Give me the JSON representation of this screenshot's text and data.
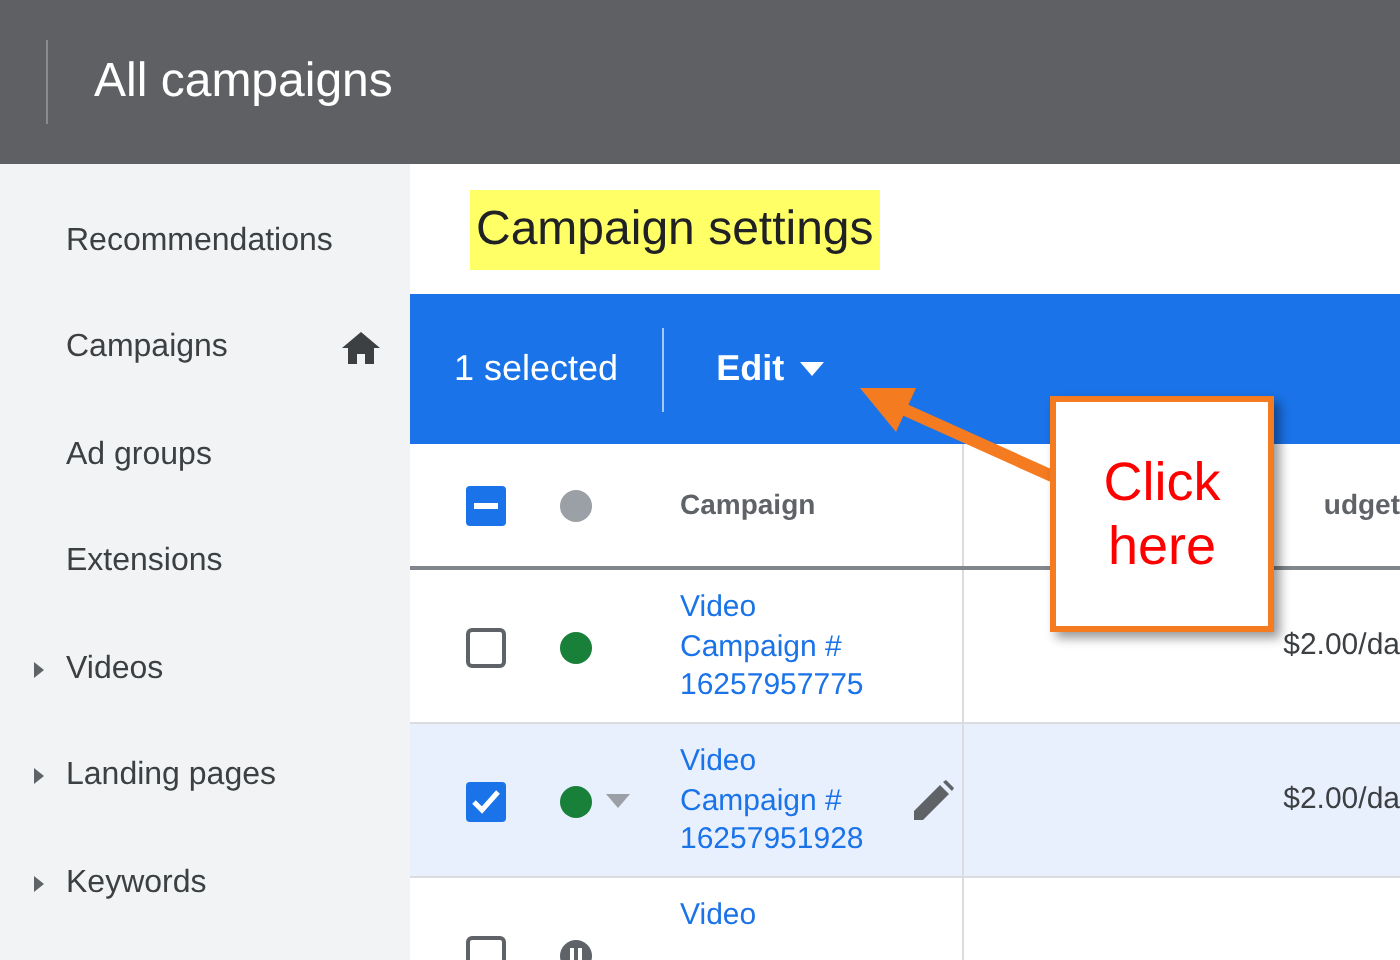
{
  "header": {
    "title": "All campaigns"
  },
  "sidebar": {
    "items": [
      {
        "label": "Recommendations",
        "expandable": false,
        "home": false
      },
      {
        "label": "Campaigns",
        "expandable": false,
        "home": true
      },
      {
        "label": "Ad groups",
        "expandable": false,
        "home": false
      },
      {
        "label": "Extensions",
        "expandable": false,
        "home": false
      },
      {
        "label": "Videos",
        "expandable": true,
        "home": false
      },
      {
        "label": "Landing pages",
        "expandable": true,
        "home": false
      },
      {
        "label": "Keywords",
        "expandable": true,
        "home": false
      }
    ]
  },
  "page_title": "Campaign settings",
  "action_bar": {
    "count": "1 selected",
    "edit": "Edit"
  },
  "table": {
    "select_all_indeterminate": true,
    "columns": [
      "Campaign",
      "udget"
    ],
    "rows": [
      {
        "selected": false,
        "kind": "enabled",
        "hovered": false,
        "campaign": "Video Campaign # 16257957775",
        "budget": "$2.00/da"
      },
      {
        "selected": true,
        "kind": "enabled",
        "hovered": true,
        "campaign": "Video Campaign # 16257951928",
        "budget": "$2.00/da"
      },
      {
        "selected": false,
        "kind": "paused",
        "hovered": false,
        "campaign": "Video"
      }
    ]
  },
  "callout": {
    "text": "Click here"
  }
}
